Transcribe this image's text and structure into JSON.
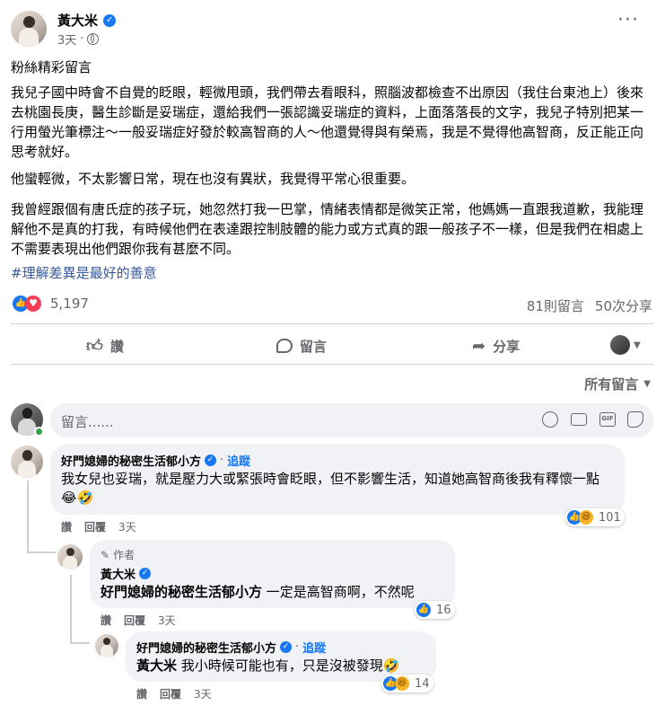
{
  "post": {
    "author": "黃大米",
    "time": "3天",
    "separator": "·",
    "title": "粉絲精彩留言",
    "paragraphs": [
      "我兒子國中時會不自覺的眨眼，輕微甩頭，我們帶去看眼科，照腦波都檢查不出原因（我住台東池上）後來去桃園長庚，醫生診斷是妥瑞症，還給我們一張認識妥瑞症的資料，上面落落長的文字，我兒子特別把某一行用螢光筆標注～一般妥瑞症好發於較高智商的人～他還覺得與有榮焉，我是不覺得他高智商，反正能正向思考就好。",
      "他蠻輕微，不太影響日常，現在也沒有異狀，我覺得平常心很重要。",
      "我曾經跟個有唐氏症的孩子玩，她忽然打我一巴掌，情緒表情都是微笑正常，他媽媽一直跟我道歉，我能理解他不是真的打我，有時候他們在表達跟控制肢體的能力或方式真的跟一般孩子不一樣，但是我們在相處上不需要表現出他們跟你我有甚麼不同。"
    ],
    "hashtag": "#理解差異是最好的善意"
  },
  "stats": {
    "reactions": "5,197",
    "comments": "81則留言",
    "shares": "50次分享"
  },
  "actions": {
    "like": "讚",
    "comment": "留言",
    "share": "分享"
  },
  "sort_label": "所有留言",
  "composer": {
    "placeholder": "留言......"
  },
  "comments": [
    {
      "name": "好門媳婦的秘密生活郁小方",
      "follow": "追蹤",
      "text": "我女兒也妥瑞，就是壓力大或緊張時會眨眼，但不影響生活，知道她高智商後我有釋懷一點😂🤣",
      "like": "讚",
      "reply": "回覆",
      "time": "3天",
      "reactions": "101"
    },
    {
      "author_badge": "作者",
      "name": "黃大米",
      "mention": "好門媳婦的秘密生活郁小方",
      "text": "一定是高智商啊，不然呢",
      "like": "讚",
      "reply": "回覆",
      "time": "3天",
      "reactions": "16"
    },
    {
      "name": "好門媳婦的秘密生活郁小方",
      "follow": "追蹤",
      "mention": "黃大米",
      "text": "我小時候可能也有，只是沒被發現🤣",
      "like": "讚",
      "reply": "回覆",
      "time": "3天",
      "reactions": "14"
    }
  ],
  "colors": {
    "accent": "#1877f2",
    "hashtag": "#385898",
    "muted": "#65676b",
    "bubble": "#f0f2f5"
  }
}
